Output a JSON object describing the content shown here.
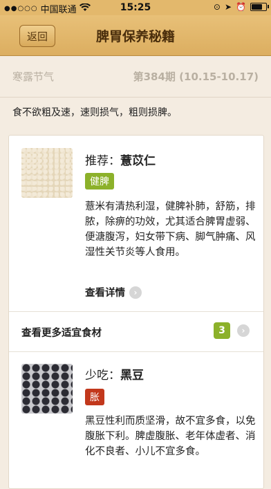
{
  "status": {
    "carrier": "中国联通",
    "time": "15:25",
    "battery_level": 0.85
  },
  "nav": {
    "back_label": "返回",
    "title": "脾胃保养秘籍"
  },
  "solar": {
    "term": "寒露节气",
    "issue": "第384期 (10.15-10.17)"
  },
  "saying": "食不欲粗及速，速则损气，粗则损脾。",
  "recommend": {
    "prefix": "推荐：",
    "food": "薏苡仁",
    "tag": "健脾",
    "description": "薏米有清热利湿，健脾补肺，舒筋，排脓，除痹的功效，尤其适合脾胃虚弱、便溏腹泻，妇女带下病、脚气肿痛、风湿性关节炎等人食用。",
    "details_label": "查看详情"
  },
  "more": {
    "label": "查看更多适宜食材",
    "count": "3"
  },
  "avoid": {
    "prefix": "少吃：",
    "food": "黑豆",
    "tag": "胀",
    "description": "黑豆性利而质坚滑，故不宜多食，以免腹胀下利。脾虚腹胀、老年体虚者、消化不良者、小儿不宜多食。"
  },
  "colors": {
    "nav": "#dcae60",
    "green_tag": "#8cb12a",
    "red_tag": "#c2381c"
  }
}
